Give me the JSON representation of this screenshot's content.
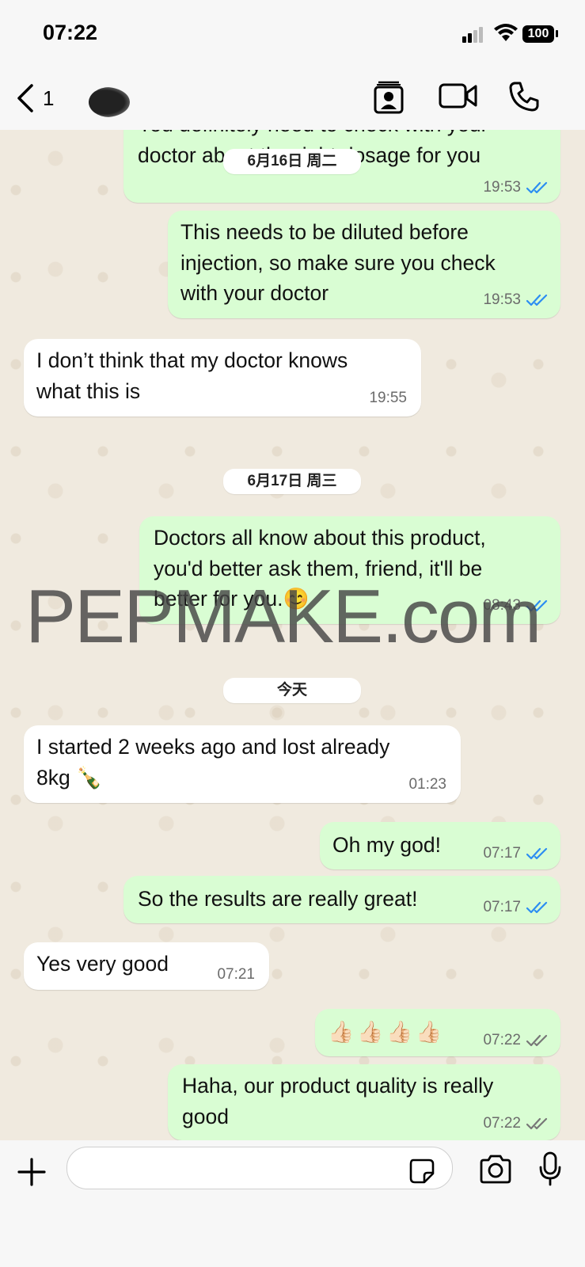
{
  "status": {
    "time": "07:22",
    "battery": "100"
  },
  "header": {
    "back_count": "1"
  },
  "date_pills": {
    "jun16": "6月16日 周二",
    "jun17": "6月17日 周三",
    "today": "今天"
  },
  "messages": [
    {
      "dir": "out",
      "text": "You definitely need to check with your\ndoctor about the right dosage for you",
      "time": "19:53",
      "status": "read"
    },
    {
      "dir": "out",
      "text": "This needs to be diluted before\ninjection, so make sure you check\nwith your doctor",
      "time": "19:53",
      "status": "read"
    },
    {
      "dir": "in",
      "text": "I don’t think that my doctor knows\nwhat this is",
      "time": "19:55"
    },
    {
      "dir": "out",
      "text": "Doctors all know about this product,\nyou'd better ask them, friend, it'll be\nbetter for you.😊",
      "time": "08:43",
      "status": "read"
    },
    {
      "dir": "in",
      "text": "I started 2 weeks ago and lost already\n8kg 🍾",
      "time": "01:23"
    },
    {
      "dir": "out",
      "text": "Oh my god!",
      "time": "07:17",
      "status": "read"
    },
    {
      "dir": "out",
      "text": "So the results are really great!",
      "time": "07:17",
      "status": "read"
    },
    {
      "dir": "in",
      "text": "Yes very good",
      "time": "07:21"
    },
    {
      "dir": "out",
      "text": "👍🏻👍🏻👍🏻👍🏻",
      "time": "07:22",
      "status": "delivered"
    },
    {
      "dir": "out",
      "text": "Haha, our product quality is really\ngood",
      "time": "07:22",
      "status": "delivered"
    }
  ],
  "watermark": "PEPMAKE.com",
  "input": {
    "placeholder": ""
  },
  "colors": {
    "read_ticks": "#2c8df2",
    "delivered_ticks": "#777777",
    "out_bubble": "#d9fdd3",
    "in_bubble": "#ffffff"
  }
}
